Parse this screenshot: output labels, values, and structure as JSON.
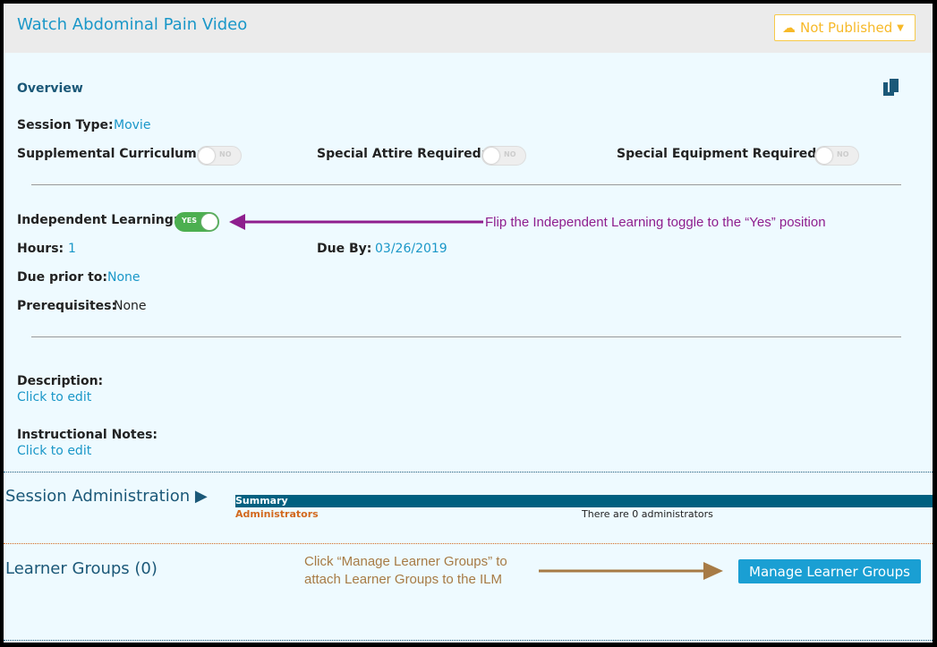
{
  "header": {
    "title": "Watch Abdominal Pain Video",
    "publish_status": "Not Published"
  },
  "overview": {
    "heading": "Overview",
    "session_type_label": "Session Type:",
    "session_type": "Movie",
    "supplemental_label": "Supplemental Curriculum:",
    "supplemental": "NO",
    "attire_label": "Special Attire Required:",
    "attire": "NO",
    "equipment_label": "Special Equipment Required:",
    "equipment": "NO",
    "independent_label": "Independent Learning:",
    "independent": "YES",
    "hours_label": "Hours:",
    "hours": "1",
    "due_by_label": "Due By:",
    "due_by": "03/26/2019",
    "due_prior_label": "Due prior to:",
    "due_prior": "None",
    "prereq_label": "Prerequisites:",
    "prereq": "None",
    "description_label": "Description:",
    "description": "Click to edit",
    "notes_label": "Instructional Notes:",
    "notes": "Click to edit"
  },
  "admin": {
    "heading": "Session Administration",
    "summary": "Summary",
    "administrators_label": "Administrators",
    "administrators_text": "There are 0 administrators"
  },
  "learner_groups": {
    "heading": "Learner Groups (0)",
    "manage_button": "Manage Learner Groups"
  },
  "annotations": {
    "toggle_note": "Flip the Independent Learning toggle to the “Yes” position",
    "manage_note_1": "Click “Manage Learner Groups” to",
    "manage_note_2": "attach Learner Groups to the ILM"
  },
  "colors": {
    "accent": "#1a97c8",
    "annotation_purple": "#8e1e8e",
    "annotation_brown": "#a77b45",
    "admin_bar": "#006080"
  }
}
